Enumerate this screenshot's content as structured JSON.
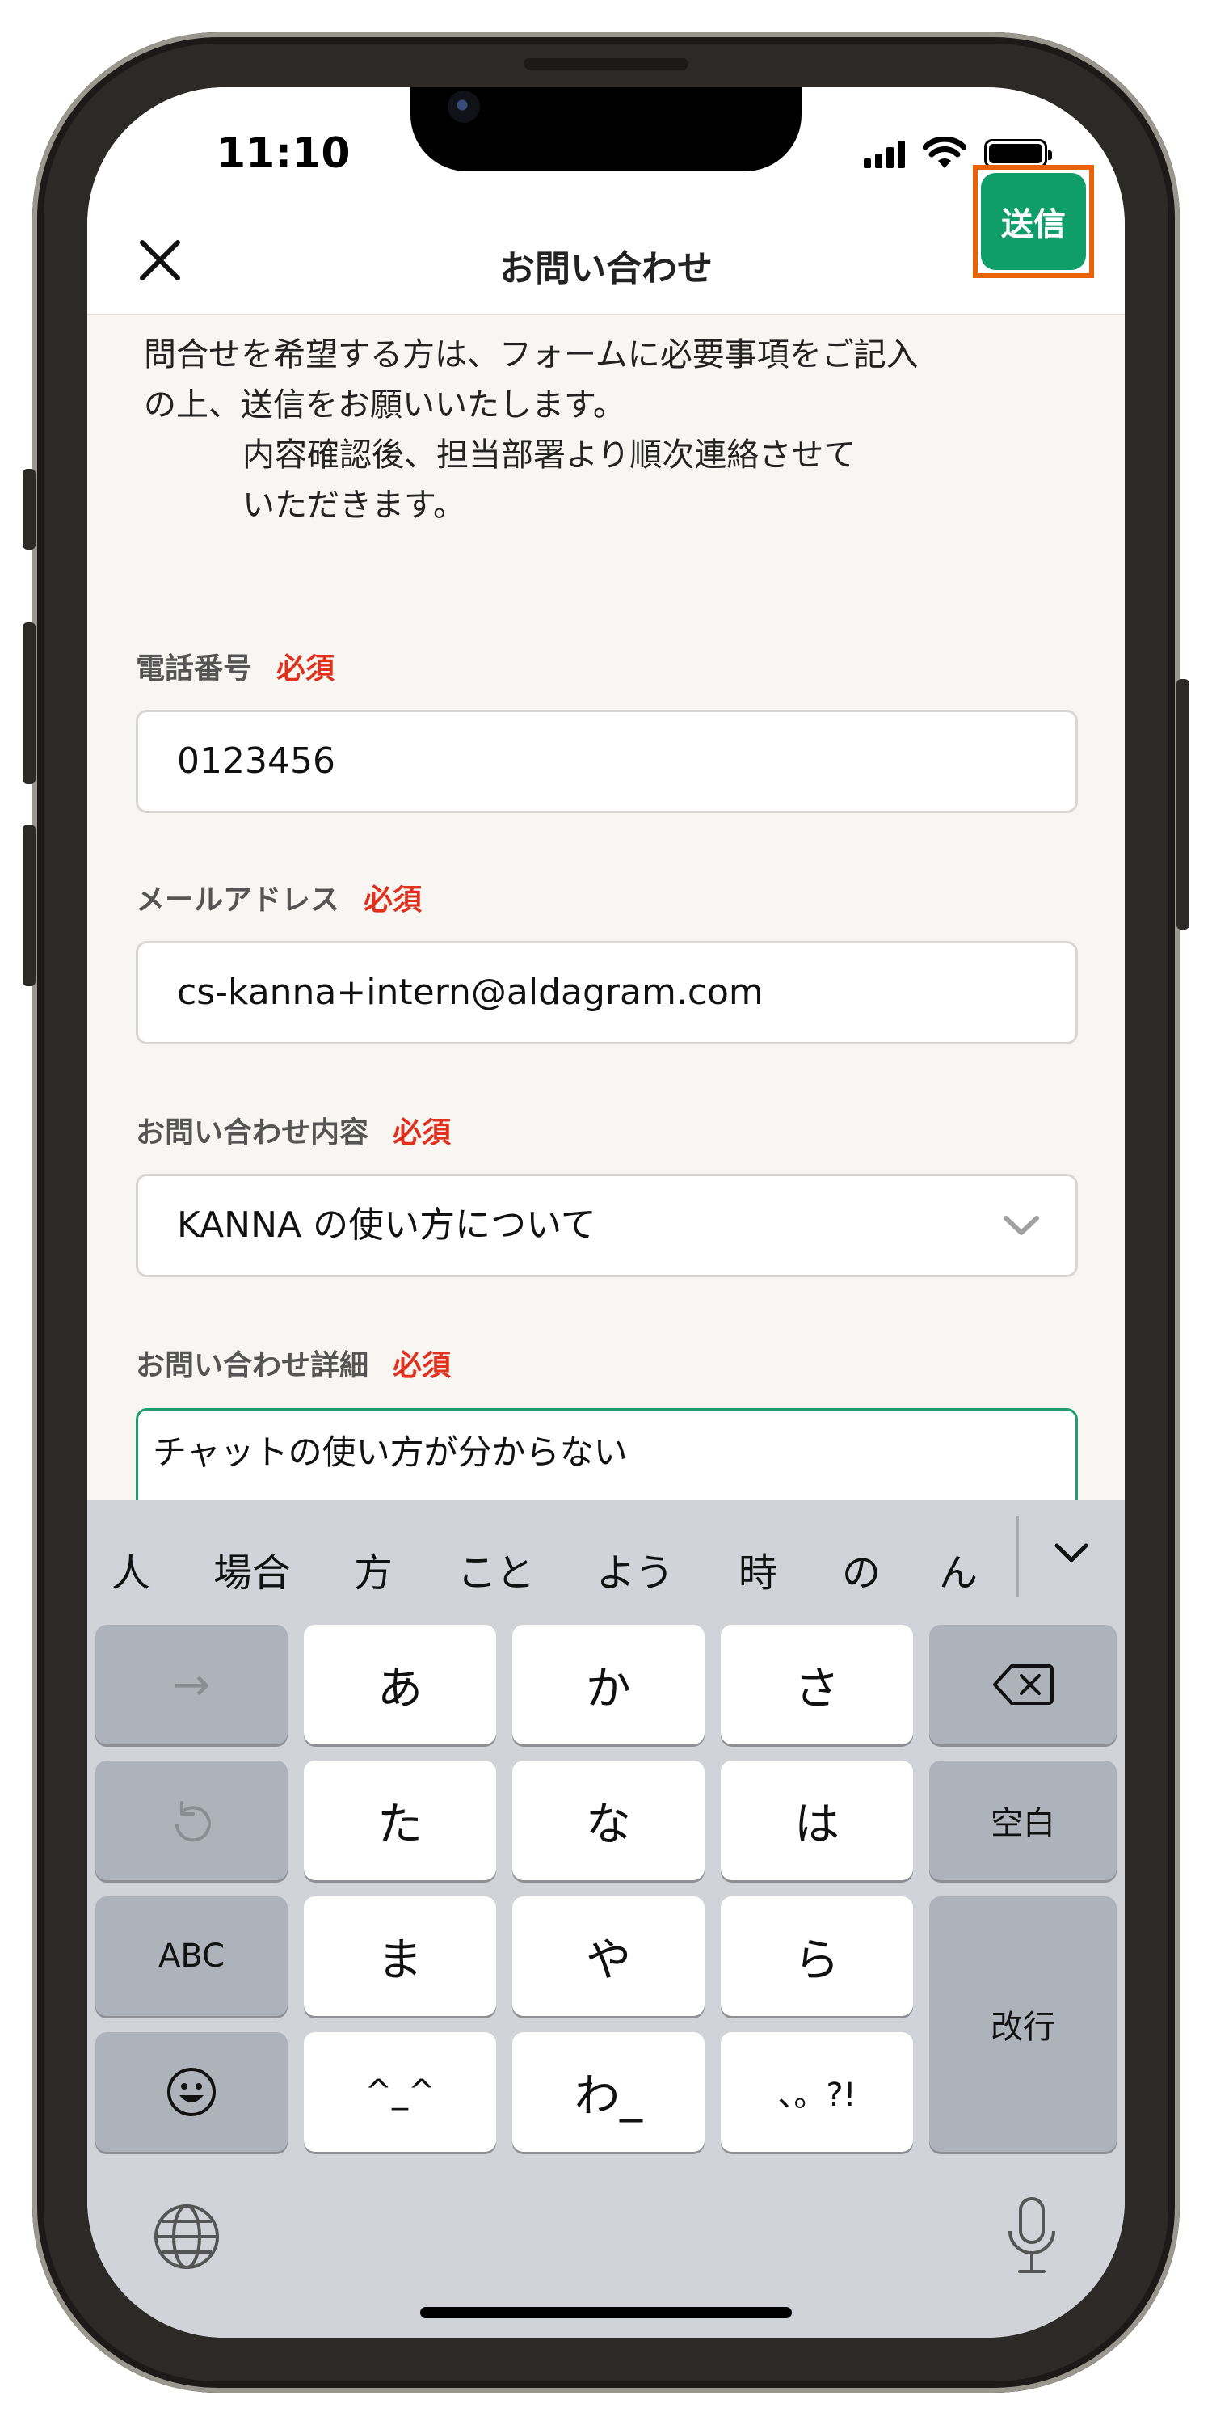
{
  "status_bar": {
    "time": "11:10"
  },
  "nav": {
    "title": "お問い合わせ",
    "send_label": "送信"
  },
  "intro": {
    "line1": "問合せを希望する方は、フォームに必要事項をご記入",
    "line2": "の上、送信をお願いいたします。",
    "line3": "内容確認後、担当部署より順次連絡させて",
    "line4": "いただきます。"
  },
  "form": {
    "phone": {
      "label": "電話番号",
      "required": "必須",
      "value": "0123456"
    },
    "email": {
      "label": "メールアドレス",
      "required": "必須",
      "value": "cs-kanna+intern@aldagram.com"
    },
    "inquiry_type": {
      "label": "お問い合わせ内容",
      "required": "必須",
      "value": "KANNA の使い方について"
    },
    "detail": {
      "label": "お問い合わせ詳細",
      "required": "必須",
      "value": "チャットの使い方が分からない"
    }
  },
  "keyboard": {
    "candidates": [
      "人",
      "場合",
      "方",
      "こと",
      "よう",
      "時",
      "の",
      "ん"
    ],
    "keys": {
      "arrow": "→",
      "a": "あ",
      "ka": "か",
      "sa": "さ",
      "ta": "た",
      "na": "な",
      "ha": "は",
      "space": "空白",
      "abc": "ABC",
      "ma": "ま",
      "ya": "や",
      "ra": "ら",
      "return": "改行",
      "kaomoji": "^_^",
      "wa": "わ_",
      "punct": "、。?!"
    }
  },
  "colors": {
    "accent_green": "#0f9d6a",
    "highlight_orange": "#e8620c",
    "required_red": "#e0301e"
  }
}
